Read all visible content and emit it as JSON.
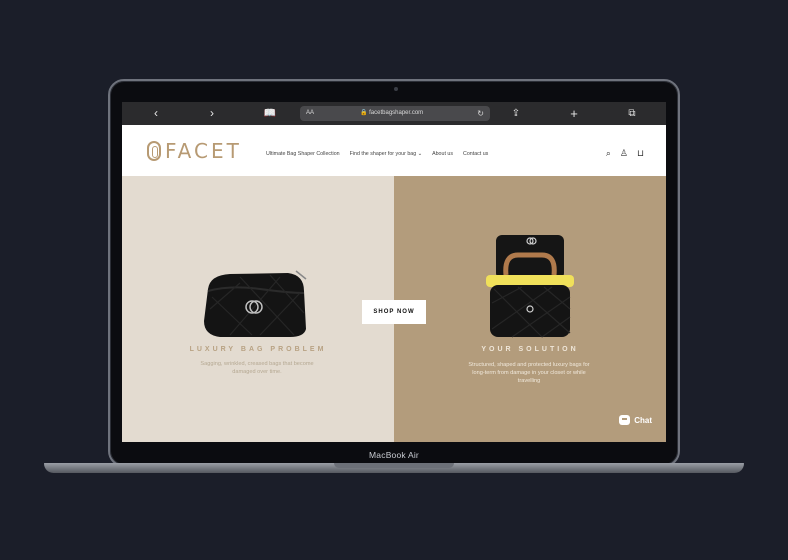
{
  "device": {
    "label": "MacBook Air"
  },
  "browser": {
    "back": "‹",
    "forward": "›",
    "text_size": "AA",
    "url": "facetbagshaper.com",
    "reload": "↻",
    "share": "⇪",
    "new_tab": "+",
    "tabs": "⧉"
  },
  "site": {
    "logo_text": "FACET",
    "nav": [
      {
        "label": "Ultimate Bag Shaper Collection"
      },
      {
        "label": "Find the shaper for your bag ⌄"
      },
      {
        "label": "About us"
      },
      {
        "label": "Contact us"
      }
    ],
    "icons": {
      "search": "⌕",
      "account": "♙",
      "cart": "⊔"
    }
  },
  "hero": {
    "left": {
      "title": "LUXURY BAG PROBLEM",
      "desc": "Sagging, wrinkled, creased bags that become damaged over time."
    },
    "right": {
      "title": "YOUR SOLUTION",
      "desc": "Structured, shaped and protected luxury bags for long-term from damage in your closet or while travelling"
    },
    "cta": "SHOP NOW"
  },
  "chat": {
    "label": "Chat"
  },
  "colors": {
    "accent": "#b79a73",
    "left_bg": "#e3dbd0",
    "right_bg": "#b39c7c"
  }
}
